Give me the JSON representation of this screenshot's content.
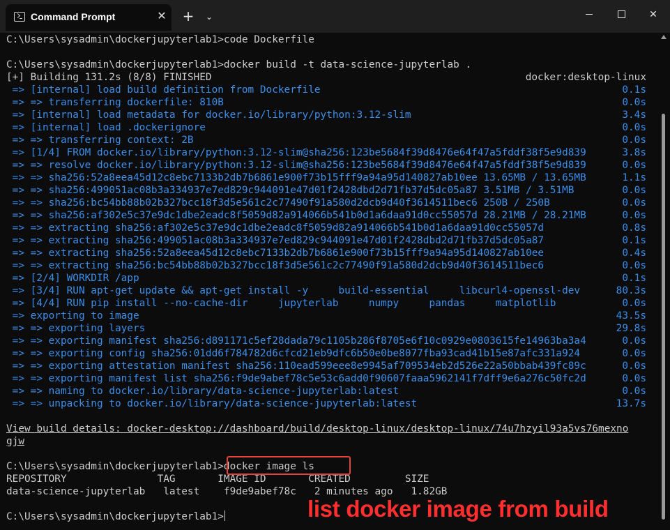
{
  "window": {
    "tab_title": "Command Prompt",
    "tab_close_glyph": "✕",
    "new_tab_glyph": "+",
    "dropdown_glyph": "⌄",
    "close_glyph": "✕",
    "icons": [
      "terminal-icon",
      "close-icon",
      "plus-icon",
      "chevron-down-icon",
      "minimize-icon",
      "maximize-icon",
      "close-icon"
    ]
  },
  "terminal": {
    "lines": [
      {
        "text": "C:\\Users\\sysadmin\\dockerjupyterlab1>code Dockerfile",
        "time": "",
        "color": "default"
      },
      {
        "text": "",
        "time": "",
        "color": "default"
      },
      {
        "text": "C:\\Users\\sysadmin\\dockerjupyterlab1>docker build -t data-science-jupyterlab .",
        "time": "",
        "color": "default"
      },
      {
        "text": "[+] Building 131.2s (8/8) FINISHED",
        "time": "docker:desktop-linux",
        "color": "default"
      },
      {
        "text": " => [internal] load build definition from Dockerfile",
        "time": "0.1s",
        "color": "blue"
      },
      {
        "text": " => => transferring dockerfile: 810B",
        "time": "0.0s",
        "color": "blue"
      },
      {
        "text": " => [internal] load metadata for docker.io/library/python:3.12-slim",
        "time": "3.4s",
        "color": "blue"
      },
      {
        "text": " => [internal] load .dockerignore",
        "time": "0.0s",
        "color": "blue"
      },
      {
        "text": " => => transferring context: 2B",
        "time": "0.0s",
        "color": "blue"
      },
      {
        "text": " => [1/4] FROM docker.io/library/python:3.12-slim@sha256:123be5684f39d8476e64f47a5fddf38f5e9d839",
        "time": "3.8s",
        "color": "blue"
      },
      {
        "text": " => => resolve docker.io/library/python:3.12-slim@sha256:123be5684f39d8476e64f47a5fddf38f5e9d839",
        "time": "0.0s",
        "color": "blue"
      },
      {
        "text": " => => sha256:52a8eea45d12c8ebc7133b2db7b6861e900f73b15fff9a94a95d140827ab10ee 13.65MB / 13.65MB",
        "time": "1.1s",
        "color": "blue"
      },
      {
        "text": " => => sha256:499051ac08b3a334937e7ed829c944091e47d01f2428dbd2d71fb37d5dc05a87 3.51MB / 3.51MB",
        "time": "0.0s",
        "color": "blue"
      },
      {
        "text": " => => sha256:bc54bb88b02b327bcc18f3d5e561c2c77490f91a580d2dcb9d40f3614511bec6 250B / 250B",
        "time": "0.0s",
        "color": "blue"
      },
      {
        "text": " => => sha256:af302e5c37e9dc1dbe2eadc8f5059d82a914066b541b0d1a6daa91d0cc55057d 28.21MB / 28.21MB",
        "time": "0.0s",
        "color": "blue"
      },
      {
        "text": " => => extracting sha256:af302e5c37e9dc1dbe2eadc8f5059d82a914066b541b0d1a6daa91d0cc55057d",
        "time": "0.8s",
        "color": "blue"
      },
      {
        "text": " => => extracting sha256:499051ac08b3a334937e7ed829c944091e47d01f2428dbd2d71fb37d5dc05a87",
        "time": "0.1s",
        "color": "blue"
      },
      {
        "text": " => => extracting sha256:52a8eea45d12c8ebc7133b2db7b6861e900f73b15fff9a94a95d140827ab10ee",
        "time": "0.4s",
        "color": "blue"
      },
      {
        "text": " => => extracting sha256:bc54bb88b02b327bcc18f3d5e561c2c77490f91a580d2dcb9d40f3614511bec6",
        "time": "0.0s",
        "color": "blue"
      },
      {
        "text": " => [2/4] WORKDIR /app",
        "time": "0.1s",
        "color": "blue"
      },
      {
        "text": " => [3/4] RUN apt-get update && apt-get install -y     build-essential     libcurl4-openssl-dev",
        "time": "80.3s",
        "color": "blue"
      },
      {
        "text": " => [4/4] RUN pip install --no-cache-dir     jupyterlab     numpy     pandas     matplotlib",
        "time": "0.0s",
        "color": "blue"
      },
      {
        "text": " => exporting to image",
        "time": "43.5s",
        "color": "blue"
      },
      {
        "text": " => => exporting layers",
        "time": "29.8s",
        "color": "blue"
      },
      {
        "text": " => => exporting manifest sha256:d891171c5ef28dada79c1105b286f8705e6f10c0929e0803615fe14963ba3a4",
        "time": "0.0s",
        "color": "blue"
      },
      {
        "text": " => => exporting config sha256:01dd6f784782d6cfcd21eb9dfc6b50e0be8077fba93cad41b15e87afc331a924",
        "time": "0.0s",
        "color": "blue"
      },
      {
        "text": " => => exporting attestation manifest sha256:110ead599eee8e9945af709534eb2d526e22a50bbab439fc89c",
        "time": "0.0s",
        "color": "blue"
      },
      {
        "text": " => => exporting manifest list sha256:f9de9abef78c5e53c6add0f90607faaa5962141f7dff9e6a276c50fc2d",
        "time": "0.0s",
        "color": "blue"
      },
      {
        "text": " => => naming to docker.io/library/data-science-jupyterlab:latest",
        "time": "0.0s",
        "color": "blue"
      },
      {
        "text": " => => unpacking to docker.io/library/data-science-jupyterlab:latest",
        "time": "13.7s",
        "color": "blue"
      },
      {
        "text": "",
        "time": "",
        "color": "default"
      },
      {
        "text": "View build details: docker-desktop://dashboard/build/desktop-linux/desktop-linux/74u7hzyil93a5vs76mexno",
        "time": "",
        "color": "default"
      },
      {
        "text": "gjw",
        "time": "",
        "color": "default"
      },
      {
        "text": "",
        "time": "",
        "color": "default"
      },
      {
        "text": "C:\\Users\\sysadmin\\dockerjupyterlab1>docker image ls",
        "time": "",
        "color": "default"
      },
      {
        "text": "REPOSITORY               TAG       IMAGE ID       CREATED         SIZE",
        "time": "",
        "color": "default"
      },
      {
        "text": "data-science-jupyterlab   latest    f9de9abef78c   2 minutes ago   1.82GB",
        "time": "",
        "color": "default"
      },
      {
        "text": "",
        "time": "",
        "color": "default"
      },
      {
        "text": "C:\\Users\\sysadmin\\dockerjupyterlab1>",
        "time": "",
        "color": "default"
      }
    ]
  },
  "annotation": {
    "text": "list docker image from build",
    "color": "#ff2f2f",
    "box_color": "#e8403a"
  },
  "colors": {
    "background": "#0c0c0c",
    "text": "#cccccc",
    "build_step": "#3b8eea",
    "titlebar": "#1f1f1f"
  }
}
